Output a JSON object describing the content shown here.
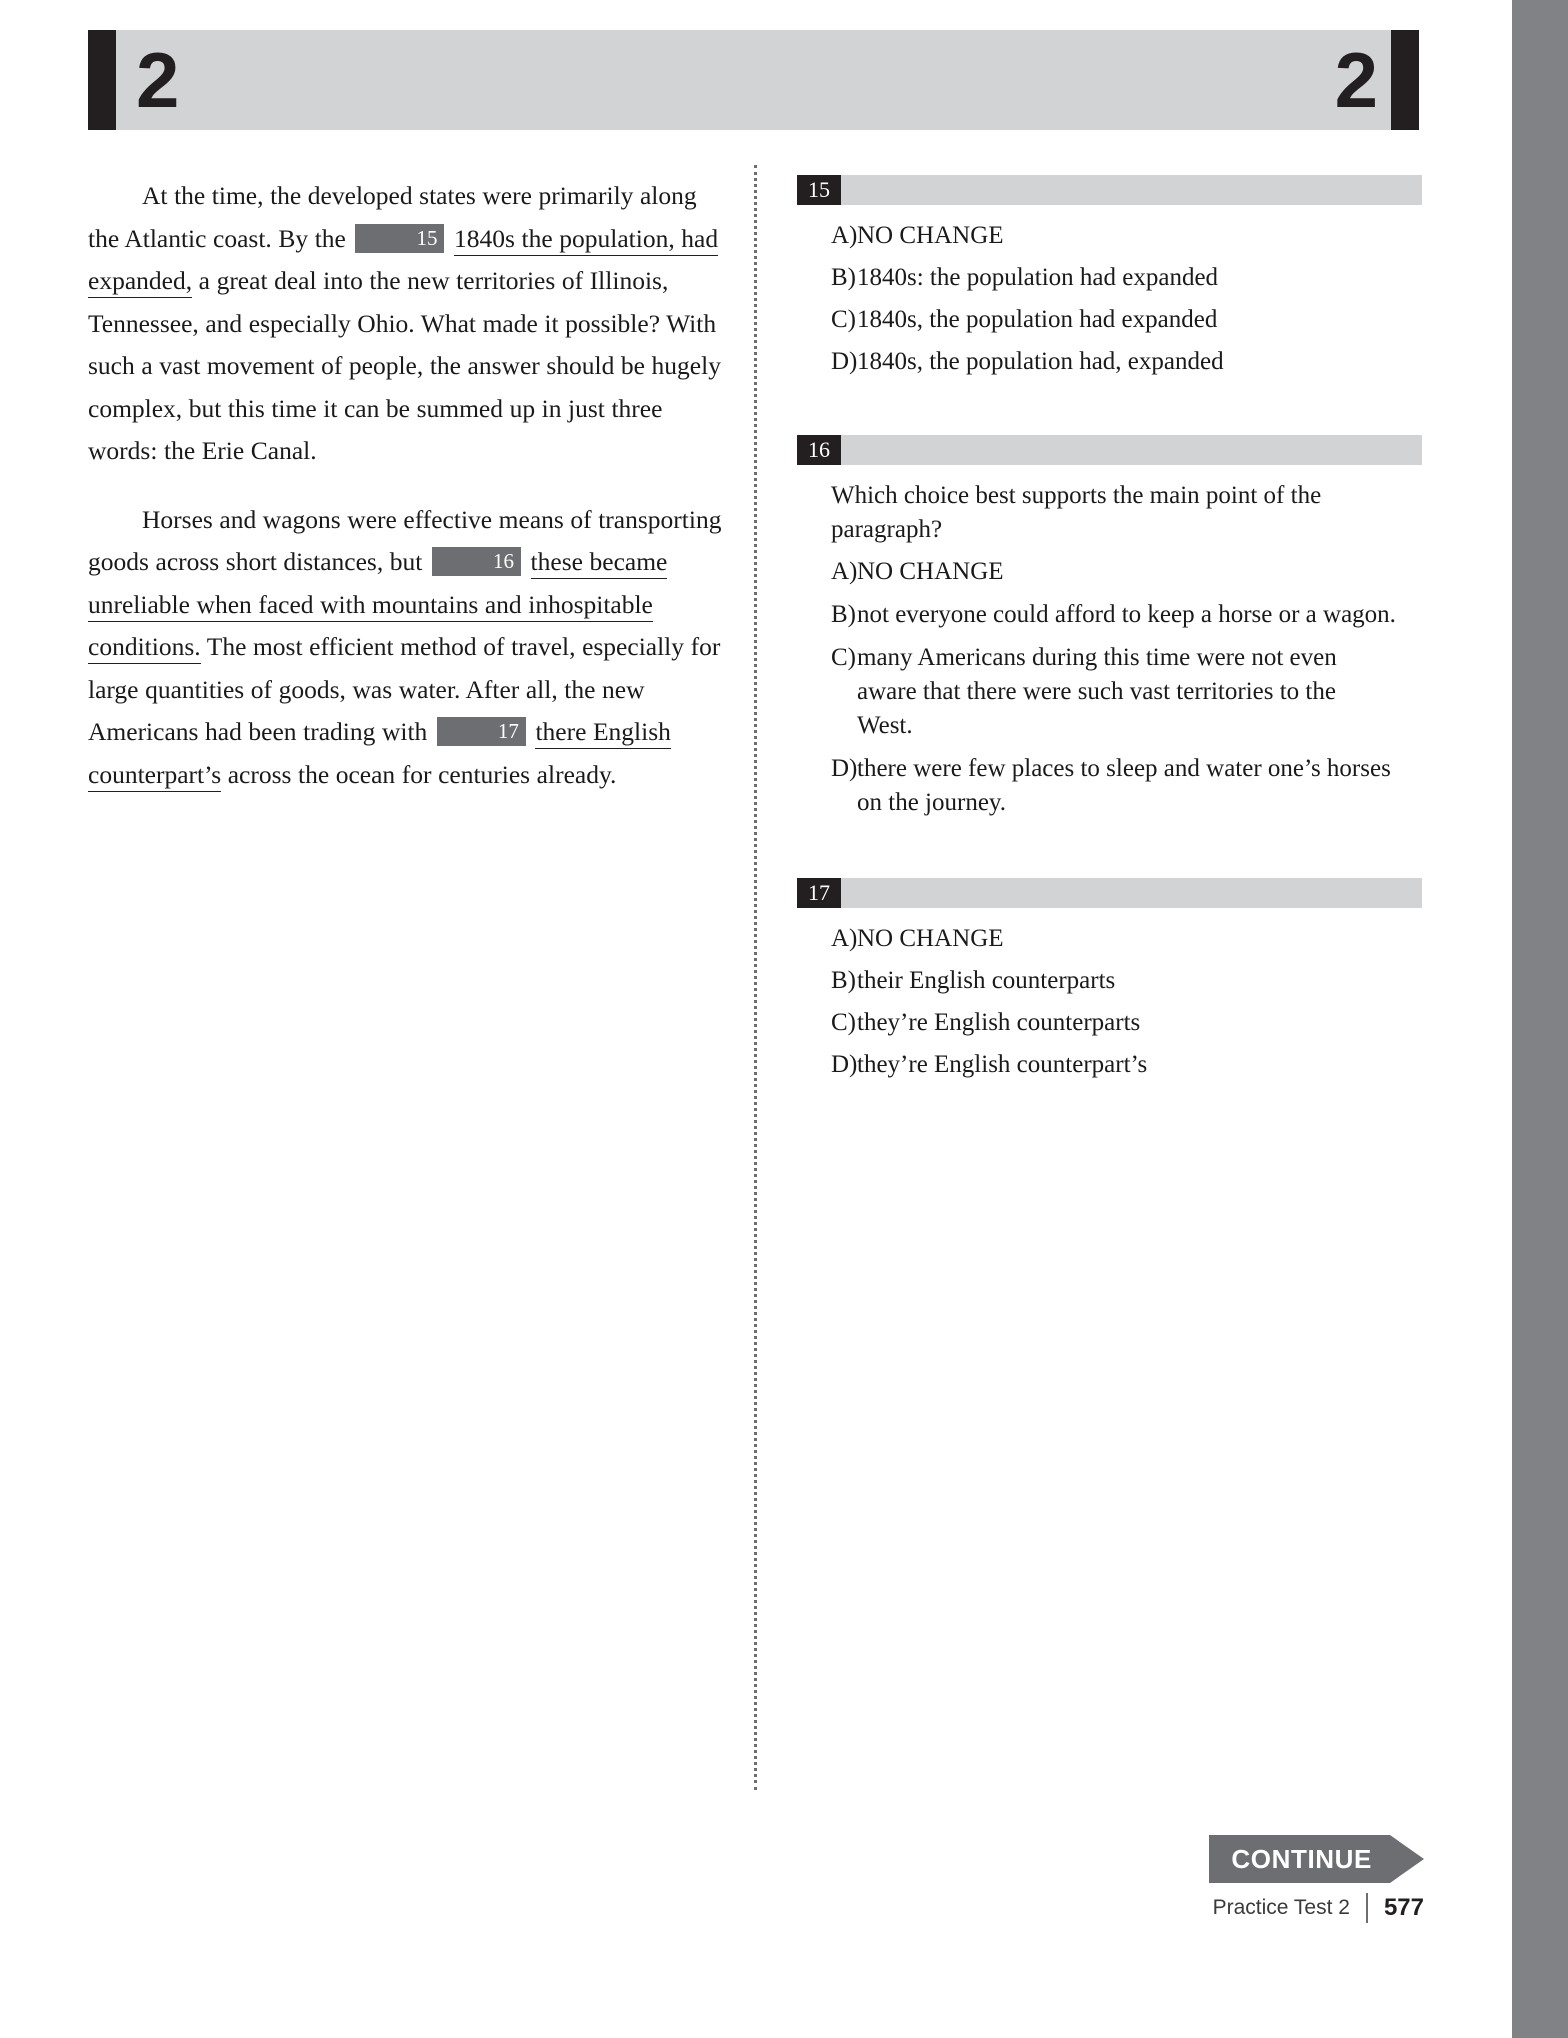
{
  "header": {
    "section_number_left": "2",
    "section_number_right": "2"
  },
  "passage": {
    "paragraph1": {
      "before_marker": "At the time, the developed states were primarily along the Atlantic coast. By the",
      "marker": "15",
      "underlined": "1840s the population, had expanded,",
      "after_marker": "a great deal into the new territories of Illinois, Tennessee, and especially Ohio. What made it possible? With such a vast movement of people, the answer should be hugely complex, but this time it can be summed up in just three words: the Erie Canal."
    },
    "paragraph2": {
      "before_marker": "Horses and wagons were effective means of transporting goods across short distances, but",
      "marker": "16",
      "underlined": "these became unreliable when faced with mountains and inhospitable conditions.",
      "middle": "The most efficient method of travel, especially for large quantities of goods, was water. After all, the new Americans had been trading with",
      "marker2": "17",
      "underlined2": "there English counterpart’s",
      "after_marker2": "across the ocean for centuries already."
    }
  },
  "questions": [
    {
      "number": "15",
      "stem": "",
      "choices": [
        {
          "letter": "A)",
          "text": "NO CHANGE"
        },
        {
          "letter": "B)",
          "text": "1840s: the population had expanded"
        },
        {
          "letter": "C)",
          "text": "1840s, the population had expanded"
        },
        {
          "letter": "D)",
          "text": "1840s, the population had, expanded"
        }
      ]
    },
    {
      "number": "16",
      "stem": "Which choice best supports the main point of the paragraph?",
      "choices": [
        {
          "letter": "A)",
          "text": "NO CHANGE"
        },
        {
          "letter": "B)",
          "text": "not everyone could afford to keep a horse or a wagon."
        },
        {
          "letter": "C)",
          "text": "many Americans during this time were not even aware that there were such vast territories to the West."
        },
        {
          "letter": "D)",
          "text": "there were few places to sleep and water one’s horses on the journey."
        }
      ]
    },
    {
      "number": "17",
      "stem": "",
      "choices": [
        {
          "letter": "A)",
          "text": "NO CHANGE"
        },
        {
          "letter": "B)",
          "text": "their English counterparts"
        },
        {
          "letter": "C)",
          "text": "they’re English counterparts"
        },
        {
          "letter": "D)",
          "text": "they’re English counterpart’s"
        }
      ]
    }
  ],
  "footer": {
    "continue_label": "CONTINUE",
    "test_label": "Practice Test 2",
    "page_number": "577"
  },
  "colors": {
    "header_band": "#d1d3d4",
    "header_bar": "#231f20",
    "badge_dark": "#231f20",
    "marker_gray": "#6d6e71",
    "edge_band": "#808285",
    "continue_gray": "#6d6e71"
  }
}
